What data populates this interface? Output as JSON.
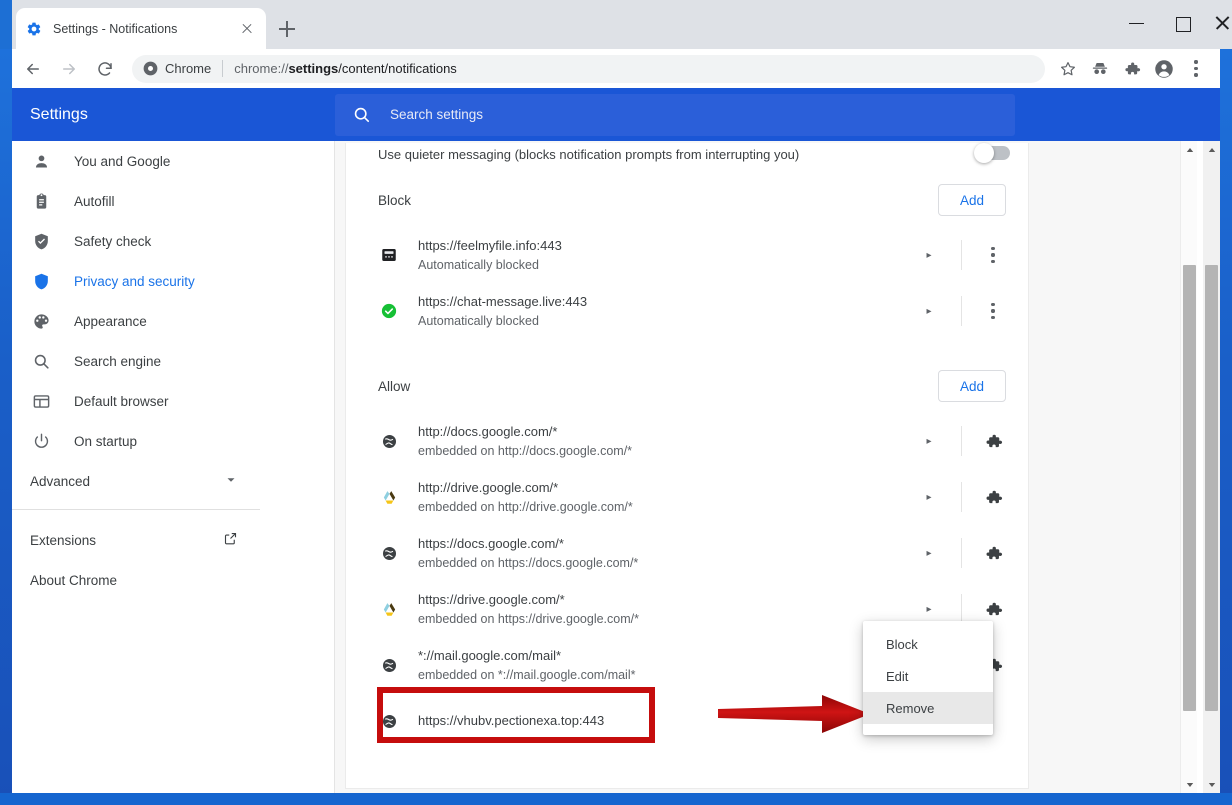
{
  "window": {
    "minimize_label": "Minimize",
    "maximize_label": "Maximize",
    "close_label": "Close"
  },
  "tabs": [
    {
      "title": "Settings - Notifications",
      "favicon": "gear-icon",
      "close_label": "Close tab"
    }
  ],
  "new_tab_label": "New tab",
  "toolbar": {
    "back_label": "Back",
    "forward_label": "Forward",
    "reload_label": "Reload",
    "chrome_badge_label": "Chrome",
    "url_scheme": "chrome://",
    "url_bold": "settings",
    "url_rest": "/content/notifications",
    "url_full": "chrome://settings/content/notifications",
    "icons": [
      "bookmark-star-icon",
      "incognito-person-icon",
      "extensions-puzzle-icon",
      "profile-avatar-icon",
      "three-dot-menu-icon"
    ]
  },
  "settings_header": {
    "title": "Settings",
    "search_placeholder": "Search settings",
    "bg_color": "#1a56d6"
  },
  "sidebar": {
    "items": [
      {
        "label": "You and Google",
        "icon": "person-icon",
        "active": false
      },
      {
        "label": "Autofill",
        "icon": "clipboard-icon",
        "active": false
      },
      {
        "label": "Safety check",
        "icon": "shield-check-icon",
        "active": false
      },
      {
        "label": "Privacy and security",
        "icon": "shield-icon",
        "active": true
      },
      {
        "label": "Appearance",
        "icon": "palette-icon",
        "active": false
      },
      {
        "label": "Search engine",
        "icon": "search-icon",
        "active": false
      },
      {
        "label": "Default browser",
        "icon": "browser-window-icon",
        "active": false
      },
      {
        "label": "On startup",
        "icon": "power-icon",
        "active": false
      }
    ],
    "advanced": {
      "label": "Advanced",
      "icon": "chevron-down-icon"
    },
    "footer": [
      {
        "label": "Extensions",
        "icon": "external-link-icon"
      },
      {
        "label": "About Chrome",
        "icon": ""
      }
    ],
    "active_color": "#1a73e8"
  },
  "content": {
    "quieter_messaging": {
      "label": "Use quieter messaging (blocks notification prompts from interrupting you)",
      "toggle_state": "off"
    },
    "block_section": {
      "title": "Block",
      "add_label": "Add",
      "rows": [
        {
          "url": "https://feelmyfile.info:443",
          "sub": "Automatically blocked",
          "favicon": "dark-server-icon",
          "caret": "▸",
          "action": "three-dot-menu-icon"
        },
        {
          "url": "https://chat-message.live:443",
          "sub": "Automatically blocked",
          "favicon": "green-check-icon",
          "caret": "▸",
          "action": "three-dot-menu-icon"
        }
      ]
    },
    "allow_section": {
      "title": "Allow",
      "add_label": "Add",
      "rows": [
        {
          "url": "http://docs.google.com/*",
          "sub": "embedded on http://docs.google.com/*",
          "favicon": "globe-icon",
          "caret": "▸",
          "action": "extensions-puzzle-icon"
        },
        {
          "url": "http://drive.google.com/*",
          "sub": "embedded on http://drive.google.com/*",
          "favicon": "drive-bee-icon",
          "caret": "▸",
          "action": "extensions-puzzle-icon"
        },
        {
          "url": "https://docs.google.com/*",
          "sub": "embedded on https://docs.google.com/*",
          "favicon": "globe-icon",
          "caret": "▸",
          "action": "extensions-puzzle-icon"
        },
        {
          "url": "https://drive.google.com/*",
          "sub": "embedded on https://drive.google.com/*",
          "favicon": "drive-bee-icon",
          "caret": "▸",
          "action": "extensions-puzzle-icon"
        },
        {
          "url": "*://mail.google.com/mail*",
          "sub": "embedded on *://mail.google.com/mail*",
          "favicon": "globe-icon",
          "caret": "▸",
          "action": "extensions-puzzle-icon"
        },
        {
          "url": "https://vhubv.pectionexa.top:443",
          "sub": "",
          "favicon": "globe-icon",
          "caret": "",
          "action": ""
        }
      ]
    }
  },
  "context_menu": {
    "items": [
      {
        "label": "Block",
        "highlighted": false
      },
      {
        "label": "Edit",
        "highlighted": false
      },
      {
        "label": "Remove",
        "highlighted": true
      }
    ]
  },
  "annotations": {
    "highlight_box_color": "#c50d0d",
    "arrow_color": "#b41010",
    "arrow_label": "red-pointer-arrow"
  },
  "scrollbars": {
    "up_arrow": "▲",
    "down_arrow": "▼"
  }
}
